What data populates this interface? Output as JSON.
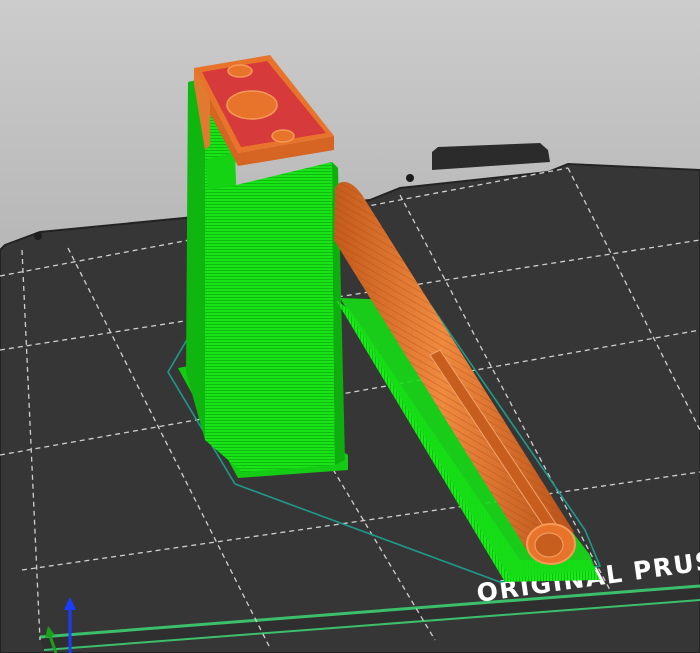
{
  "viewport": {
    "bed_label": "ORIGINAL PRUSA"
  },
  "colors": {
    "background_top": "#c9c9c9",
    "background_bottom": "#9a9a9a",
    "bed": "#373737",
    "bed_edge": "#1f1f1f",
    "grid": "#d6d6d6",
    "support": "#16e016",
    "support_dark": "#0fb80f",
    "perimeter": "#e8742b",
    "perimeter_dark": "#c85e1e",
    "top_infill": "#d63a3a",
    "skirt": "#1f9a8a",
    "bed_rim": "#3cbf6b",
    "axis_z": "#1a3cff",
    "axis_y": "#1aa01a"
  },
  "icons": {
    "axes": "xyz-axes-icon"
  }
}
